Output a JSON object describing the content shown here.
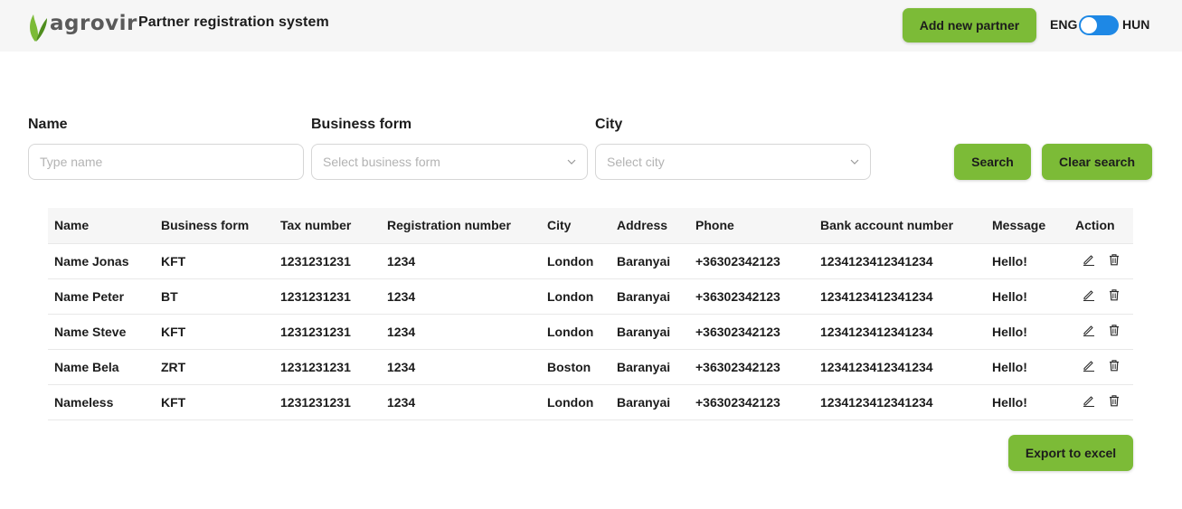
{
  "header": {
    "logo_text": "agrovir",
    "title": "Partner registration system",
    "add_button": "Add new partner",
    "lang_left": "ENG",
    "lang_right": "HUN"
  },
  "filters": {
    "name_label": "Name",
    "name_placeholder": "Type name",
    "business_label": "Business form",
    "business_placeholder": "Select business form",
    "city_label": "City",
    "city_placeholder": "Select city",
    "search_button": "Search",
    "clear_button": "Clear search"
  },
  "table": {
    "columns": [
      "Name",
      "Business form",
      "Tax number",
      "Registration number",
      "City",
      "Address",
      "Phone",
      "Bank account number",
      "Message",
      "Action"
    ],
    "rows": [
      {
        "name": "Name Jonas",
        "business_form": "KFT",
        "tax": "1231231231",
        "reg": "1234",
        "city": "London",
        "address": "Baranyai",
        "phone": "+36302342123",
        "bank": "1234123412341234",
        "message": "Hello!"
      },
      {
        "name": "Name Peter",
        "business_form": "BT",
        "tax": "1231231231",
        "reg": "1234",
        "city": "London",
        "address": "Baranyai",
        "phone": "+36302342123",
        "bank": "1234123412341234",
        "message": "Hello!"
      },
      {
        "name": "Name Steve",
        "business_form": "KFT",
        "tax": "1231231231",
        "reg": "1234",
        "city": "London",
        "address": "Baranyai",
        "phone": "+36302342123",
        "bank": "1234123412341234",
        "message": "Hello!"
      },
      {
        "name": "Name Bela",
        "business_form": "ZRT",
        "tax": "1231231231",
        "reg": "1234",
        "city": "Boston",
        "address": "Baranyai",
        "phone": "+36302342123",
        "bank": "1234123412341234",
        "message": "Hello!"
      },
      {
        "name": "Nameless",
        "business_form": "KFT",
        "tax": "1231231231",
        "reg": "1234",
        "city": "London",
        "address": "Baranyai",
        "phone": "+36302342123",
        "bank": "1234123412341234",
        "message": "Hello!"
      }
    ]
  },
  "export_button": "Export to excel",
  "colors": {
    "accent_green": "#7cbb37",
    "toggle_blue": "#1e88e5",
    "header_bg": "#f6f6f6"
  },
  "icons": {
    "edit": "pencil-icon",
    "delete": "trash-icon",
    "dropdown": "chevron-down-icon"
  }
}
